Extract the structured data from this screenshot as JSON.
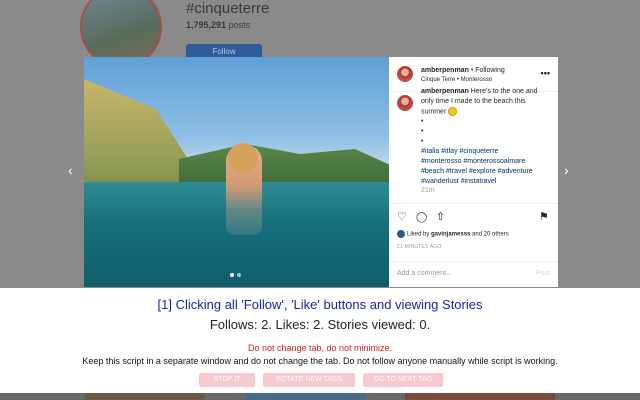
{
  "profile": {
    "hashtag": "#cinqueterre",
    "posts_count": "1,795,291",
    "posts_label": "posts",
    "follow_label": "Follow"
  },
  "post": {
    "username": "amberpenman",
    "following": "• Following",
    "location": "Cinque Terre • Monterosso",
    "more": "•••",
    "caption": {
      "user": "amberpenman",
      "line1": " Here's to the one and",
      "line2": "only time I made to the beach this",
      "line3": "summer",
      "bullets": [
        "•",
        "•",
        "•"
      ],
      "hashtags": [
        "#italia #itlay #cinqueterre",
        "#monterosso #monterossoalmare",
        "#beach #travel #explore #adventure",
        "#wanderlust #instatravel"
      ]
    },
    "time_ago": "21m",
    "liked_by_prefix": "Liked by ",
    "liked_by_user": "gavinjamesss",
    "liked_by_suffix": " and 20 others",
    "minutes_ago": "21 MINUTES AGO",
    "comment_placeholder": "Add a comment...",
    "post_label": "Post"
  },
  "banner": {
    "status_line": "[1] Clicking all 'Follow', 'Like' buttons and viewing Stories",
    "counts_line": "Follows: 2. Likes: 2. Stories viewed: 0.",
    "warning": "Do not change tab, do not minimize.",
    "instruction": "Keep this script in a separate window and do not change the tab. Do not follow anyone manually while script is working.",
    "buttons": [
      "STOP IT",
      "ROTATE NEW TAGS",
      "GO TO NEXT TAG"
    ]
  },
  "icons": {
    "left_arrow": "‹",
    "right_arrow": "›",
    "heart": "♡",
    "comment": "◯",
    "share": "⇧",
    "bookmark": "⚑",
    "next_photo": "›"
  }
}
